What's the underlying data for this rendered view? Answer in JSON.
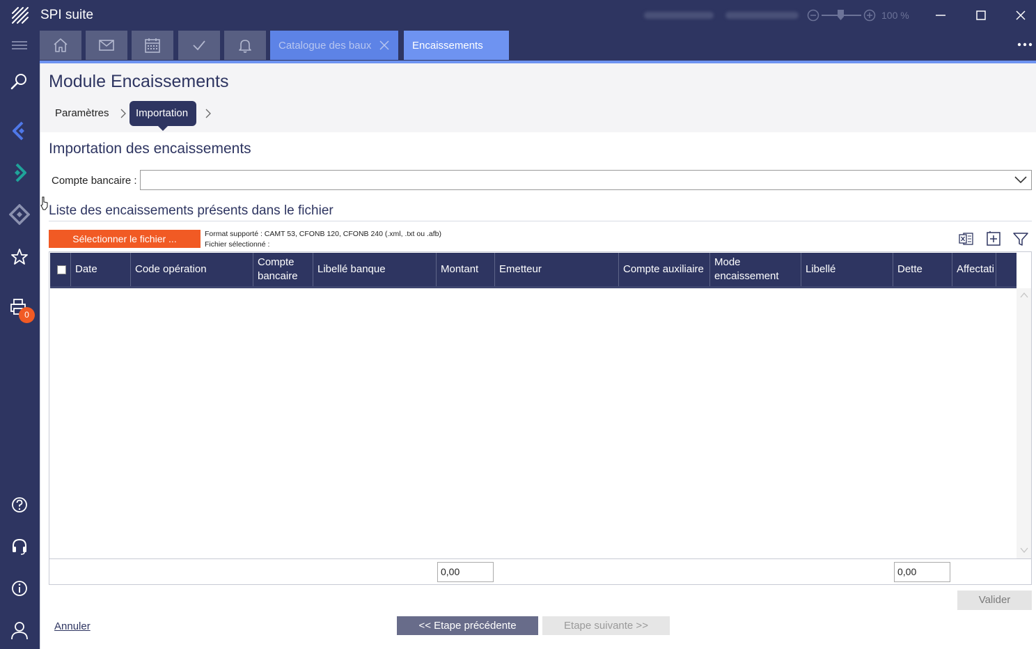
{
  "app": {
    "title": "SPI suite",
    "zoom": "100 %"
  },
  "tabs": [
    {
      "kind": "icon",
      "icon": "home-icon"
    },
    {
      "kind": "icon",
      "icon": "mail-icon"
    },
    {
      "kind": "icon",
      "icon": "calendar-icon"
    },
    {
      "kind": "icon",
      "icon": "check-icon"
    },
    {
      "kind": "icon",
      "icon": "bell-icon"
    },
    {
      "kind": "text",
      "label": "Catalogue des baux",
      "closable": true
    },
    {
      "kind": "text",
      "label": "Encaissements",
      "active": true
    }
  ],
  "sidebar": {
    "items": [
      "menu-icon",
      "search-icon",
      "back-arrow-icon",
      "forward-arrow-icon",
      "diamond-nav-icon",
      "star-icon",
      "printer-icon",
      "help-icon",
      "headset-icon",
      "info-icon",
      "user-icon"
    ],
    "print_badge": "0"
  },
  "page": {
    "module_title": "Module Encaissements",
    "breadcrumb": {
      "step1": "Paramètres",
      "step2": "Importation"
    },
    "section_title": "Importation des encaissements",
    "account_label": "Compte bancaire :",
    "account_value": "",
    "list_title": "Liste des encaissements présents dans le fichier",
    "select_file_button": "Sélectionner le fichier ...",
    "format_info": "Format supporté : CAMT 53, CFONB 120, CFONB 240 (.xml, .txt ou .afb)",
    "file_info": "Fichier sélectionné :"
  },
  "grid": {
    "columns": [
      "Date",
      "Code opération",
      "Compte bancaire",
      "Libellé banque",
      "Montant",
      "Emetteur",
      "Compte auxiliaire",
      "Mode encaissement",
      "Libellé",
      "Dette",
      "Affectati"
    ],
    "rows": [],
    "totals": {
      "montant": "0,00",
      "dette": "0,00"
    }
  },
  "actions": {
    "validate": "Valider",
    "cancel": "Annuler",
    "previous": "<< Etape précédente",
    "next": "Etape suivante >>"
  },
  "colors": {
    "navy": "#2e3561",
    "accent_blue": "#6e93f1",
    "orange": "#f15a24"
  }
}
